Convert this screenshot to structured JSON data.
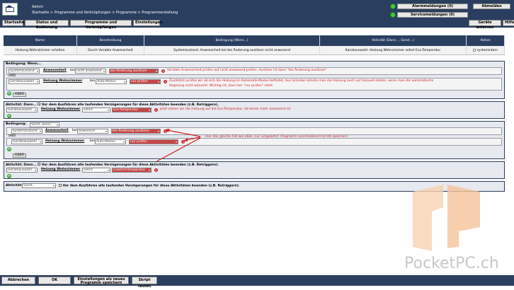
{
  "header": {
    "user": "Admin",
    "breadcrumb": "Startseite > Programme und Verknüpfungen > Programme > Programmerstellung",
    "alarm_label": "Alarmmeldungen (0)",
    "service_label": "Servicemeldungen (0)",
    "logout_label": "Abmelden",
    "colors": {
      "bar": "#2a3f60",
      "led": "#4cc640"
    }
  },
  "toolbar": {
    "items": [
      "Startseite",
      "Status und Bedienung",
      "Programme und Verknüpfungen",
      "Einstellungen"
    ],
    "right_items": [
      "Geräte anlernen",
      "Hilfe"
    ]
  },
  "table": {
    "headers": [
      "Name",
      "Beschreibung",
      "Bedingung (Wenn...)",
      "Aktivität (Dann..., Sonst...)",
      "Aktion"
    ],
    "row": [
      "Heizung Wohnzimmer schalten",
      "Durch Variable Anwesenheit",
      "Systemzustand: Anwesenheit bei bei Änderung auslösen nicht anwesend",
      "Kanalauswahl: Heizung Wohnzimmer sofort Eco-Temperatur",
      "systemintern"
    ]
  },
  "block1": {
    "title": "Bedingung: Wenn...",
    "row1": {
      "sel1": "Systemzustand",
      "name": "Anwesenheit",
      "bei": "bei",
      "sel2": "nicht anwesend",
      "sel3": "bei Änderung auslösen",
      "note": "Variable Anwesenheit prüfen auf nicht anwesend prüfen. Auslöser ist dann \"bei Änderung auslösen\""
    },
    "und": "UND",
    "row2": {
      "sel1": "Geräteauswahl",
      "name": "Heizung Wohnzimmer",
      "bei": "bei",
      "sel2": "Auto-Modus",
      "sel3": "nur prüfen",
      "note1": "Zusätzlich prüfen wir ob sich die Heizung im Automatik-Modus befindet. Aus Gründen könnte man die Heizung auch auf manuell stellen, wenn man die automatische",
      "note2": "Regelung nicht wünscht. Wichtig ist, dass hier \"nur prüfen\" steht"
    },
    "oder": "ODER"
  },
  "block2": {
    "title": "Aktivität: Dann...",
    "check": "Vor dem Ausführen alle laufenden Verzögerungen für diese Aktivitäten beenden (z.B. Retriggern).",
    "sel1": "Geräteauswahl",
    "name": "Heizung Wohnzimmer",
    "sel2": "sofort",
    "sel3": "Eco-Temperatur",
    "note": "Jetzt setzen wir die Heizung auf die Eco-Temperatur, da keiner mehr anwesend ist"
  },
  "block3": {
    "title": "Bedingung:",
    "title_sel": "Sonst, wenn...",
    "row1": {
      "sel1": "Systemzustand",
      "name": "Anwesenheit",
      "bei": "bei",
      "sel2": "anwesend",
      "sel3": "bei Änderung auslösen"
    },
    "und": "UND",
    "row2": {
      "sel1": "Geräteauswahl",
      "name": "Heizung Wohnzimmer",
      "bei": "bei",
      "sel2": "Auto-Modus",
      "sel3": "nur prüfen"
    },
    "note": "Hier das gleiche Fall wie oben, nur umgekehrt. Programm anschließend mit OK speichern",
    "oder": "ODER"
  },
  "block4": {
    "title": "Aktivität: Dann...",
    "check": "Vor dem Ausführen alle laufenden Verzögerungen für diese Aktivitäten beenden (z.B. Retriggern).",
    "sel1": "Geräteauswahl",
    "name": "Heizung Wohnzimmer",
    "sel2": "sofort",
    "sel3": "Comfort-Temperatur"
  },
  "block5": {
    "title": "Aktivität:",
    "sel": "Sonst...",
    "check": "Vor dem Ausführen alle laufenden Verzögerungen für diese Aktivitäten beenden (z.B. Retriggern)."
  },
  "bottom": {
    "cancel": "Abbrechen",
    "ok": "OK",
    "save_line1": "Einstellungen als neues",
    "save_line2": "Programm speichern",
    "test": "Skript testen"
  },
  "watermark": "PocketPC.ch"
}
